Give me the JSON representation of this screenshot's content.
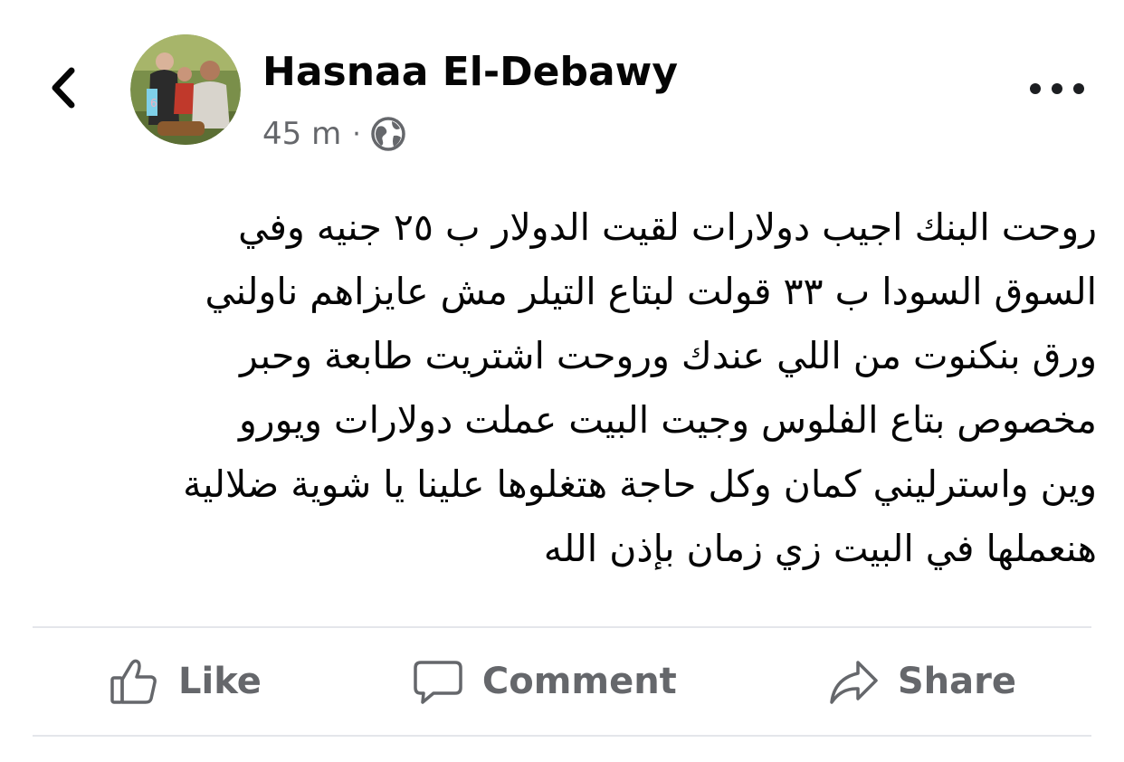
{
  "colors": {
    "text_primary": "#050505",
    "text_secondary": "#65676b",
    "divider": "#e4e6eb",
    "background": "#ffffff"
  },
  "header": {
    "back_icon": "chevron-left-icon",
    "author_name": "Hasnaa El-Debawy",
    "timestamp": "45 m",
    "separator": "·",
    "audience_icon": "globe-icon",
    "more_icon": "more-horizontal-icon"
  },
  "post": {
    "lines": [
      "روحت البنك اجيب دولارات لقيت الدولار ب ٢٥ جنيه وفي",
      "السوق السودا ب ٣٣ قولت لبتاع التيلر مش عايزاهم ناولني",
      "ورق بنكنوت من اللي عندك وروحت اشتريت طابعة وحبر",
      "مخصوص بتاع الفلوس وجيت البيت عملت دولارات ويورو",
      "وين واسترليني كمان وكل حاجة هتغلوها علينا يا شوية ضلالية",
      "هنعملها في البيت زي زمان بإذن الله"
    ]
  },
  "actions": [
    {
      "label": "Like",
      "icon": "thumbs-up-icon"
    },
    {
      "label": "Comment",
      "icon": "comment-icon"
    },
    {
      "label": "Share",
      "icon": "share-icon"
    }
  ]
}
